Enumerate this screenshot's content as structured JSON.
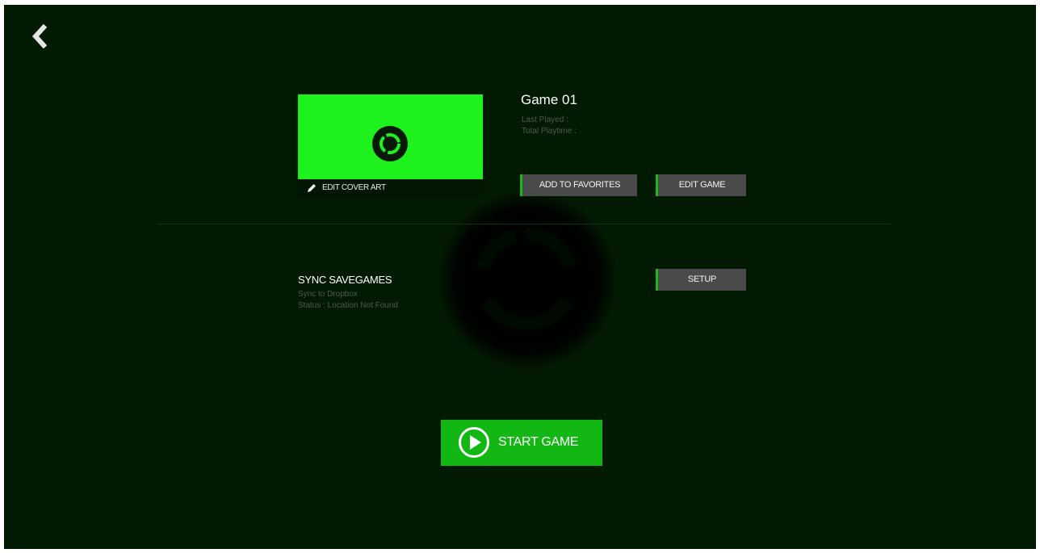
{
  "nav": {
    "back_icon": "chevron-left-icon"
  },
  "game": {
    "title": "Game 01",
    "last_played_label": "Last Played :",
    "total_playtime_label": "Total Playtime :",
    "edit_cover_label": "EDIT COVER ART",
    "add_favorites_label": "ADD TO FAVORITES",
    "edit_game_label": "EDIT GAME"
  },
  "sync": {
    "title": "SYNC SAVEGAMES",
    "target": "Sync to Dropbox",
    "status": "Status : Location Not Found",
    "setup_label": "SETUP"
  },
  "start": {
    "label": "START GAME",
    "icon": "play-circle-icon"
  },
  "colors": {
    "background": "#021a02",
    "accent": "#1df21d",
    "start_button": "#13b713",
    "button_gray": "#4a4a4a",
    "muted_text": "#4b5a4b"
  }
}
